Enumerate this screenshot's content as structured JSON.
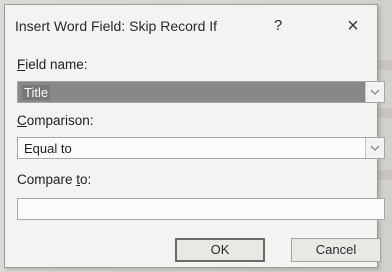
{
  "dialog": {
    "title": "Insert Word Field: Skip Record If",
    "help_label": "?",
    "close_label": "×"
  },
  "field_name": {
    "label_access": "F",
    "label_rest": "ield name:",
    "value": "Title"
  },
  "comparison": {
    "label_access": "C",
    "label_rest": "omparison:",
    "value": "Equal to"
  },
  "compare_to": {
    "label_start": "Compare ",
    "label_access": "t",
    "label_rest": "o:",
    "value": ""
  },
  "buttons": {
    "ok": "OK",
    "cancel": "Cancel"
  },
  "icons": {
    "dropdown": "chevron-down-icon"
  }
}
